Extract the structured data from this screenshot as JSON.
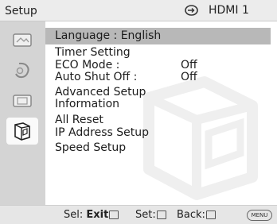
{
  "header": {
    "title": "Setup",
    "source_icon": "input-source-icon",
    "source_label": "HDMI 1"
  },
  "sidebar": {
    "items": [
      {
        "icon": "picture-icon",
        "active": false
      },
      {
        "icon": "sound-icon",
        "active": false
      },
      {
        "icon": "screen-icon",
        "active": false
      },
      {
        "icon": "setup-icon",
        "active": true
      }
    ]
  },
  "menu": {
    "items": [
      {
        "label": "Language :  English",
        "selected": true
      },
      {
        "label": "Timer Setting"
      },
      {
        "label": "ECO Mode :",
        "value": "Off"
      },
      {
        "label": "Auto Shut Off :",
        "value": "Off"
      },
      {
        "label": "Advanced Setup"
      },
      {
        "label": "Information"
      },
      {
        "label": "All Reset"
      },
      {
        "label": "IP Address Setup"
      },
      {
        "label": "Speed Setup"
      }
    ]
  },
  "footer": {
    "sel_label": "Sel:",
    "exit_label": "Exit",
    "set_label": "Set:",
    "back_label": "Back:",
    "menu_label": "MENU"
  },
  "colors": {
    "selected_row": "#b8b8b8",
    "panel": "#ffffff",
    "sidebar": "#d4d4d4"
  }
}
